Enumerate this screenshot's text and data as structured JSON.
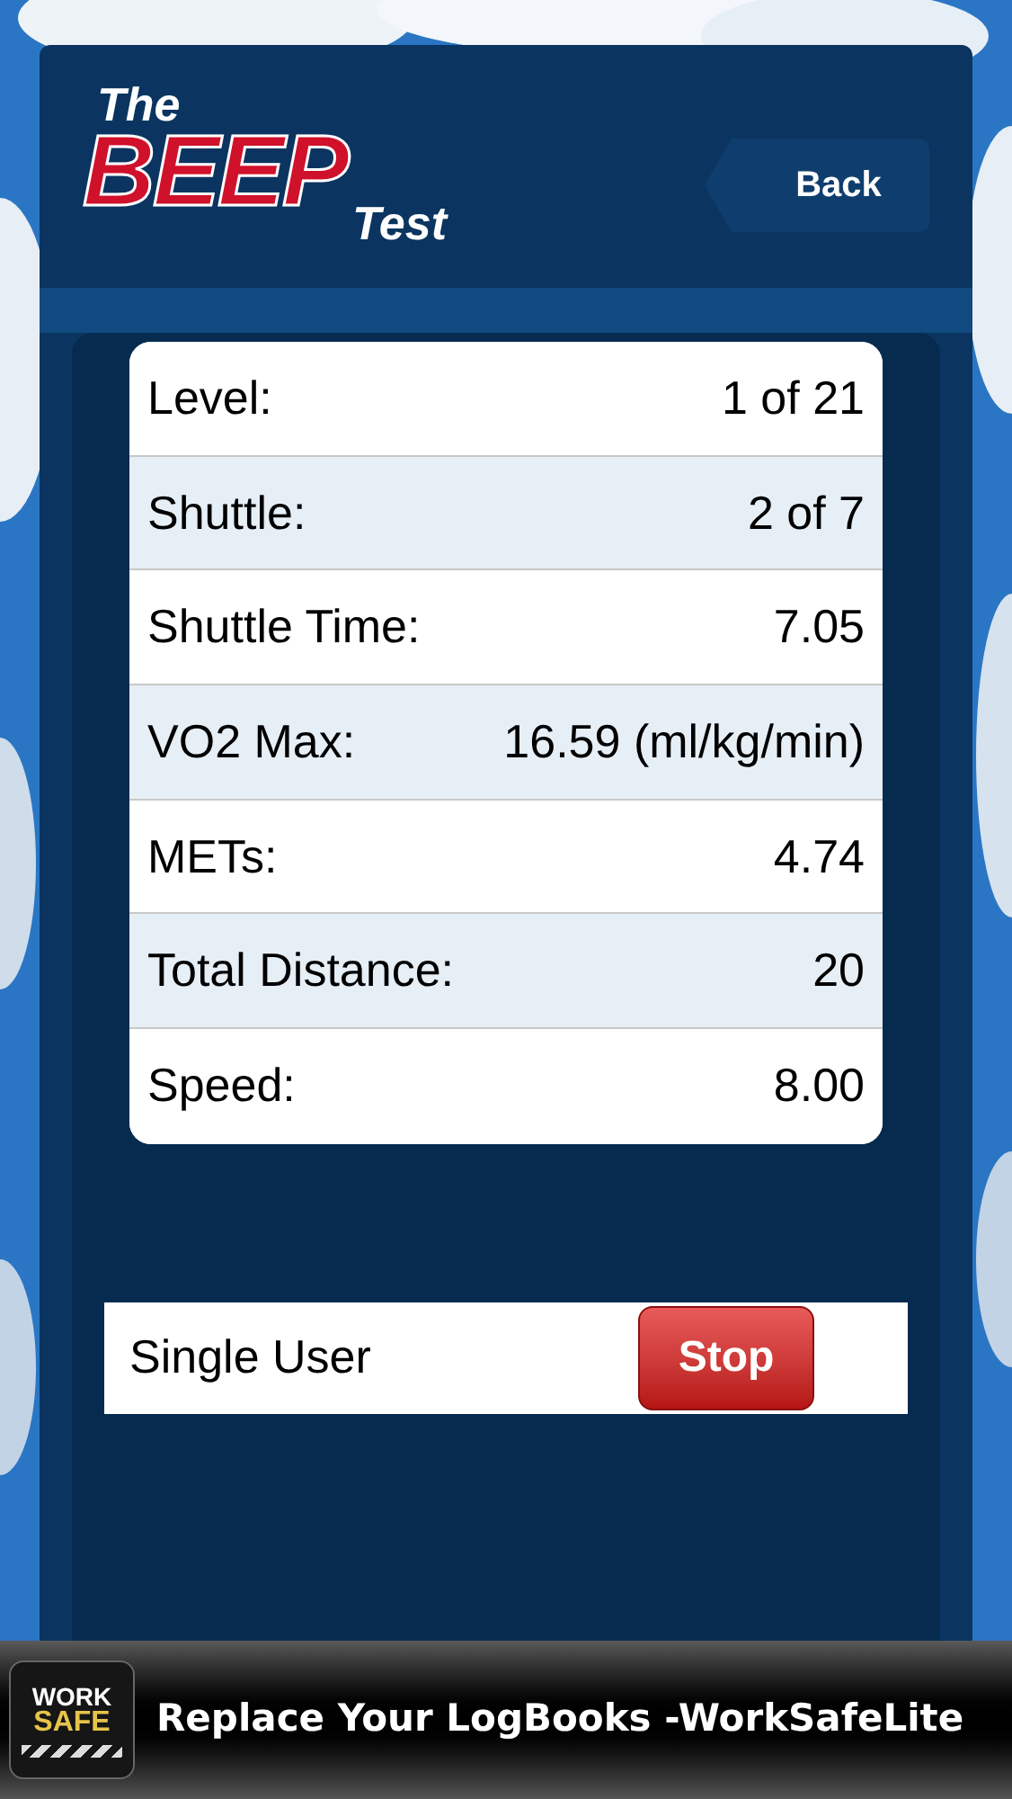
{
  "logo": {
    "top": "The",
    "main": "BEEP",
    "bottom": "Test"
  },
  "back_button": {
    "label": "Back"
  },
  "stats": [
    {
      "label": "Level:",
      "value": "1 of 21"
    },
    {
      "label": "Shuttle:",
      "value": "2 of 7"
    },
    {
      "label": "Shuttle Time:",
      "value": "7.05"
    },
    {
      "label": "VO2 Max:",
      "value": "16.59 (ml/kg/min)"
    },
    {
      "label": "METs:",
      "value": "4.74"
    },
    {
      "label": "Total Distance:",
      "value": "20"
    },
    {
      "label": "Speed:",
      "value": "8.00"
    }
  ],
  "mode": {
    "label": "Single User",
    "button": "Stop"
  },
  "ad": {
    "icon_top": "WORK",
    "icon_bottom": "SAFE",
    "text": "Replace Your LogBooks -WorkSafeLite"
  }
}
